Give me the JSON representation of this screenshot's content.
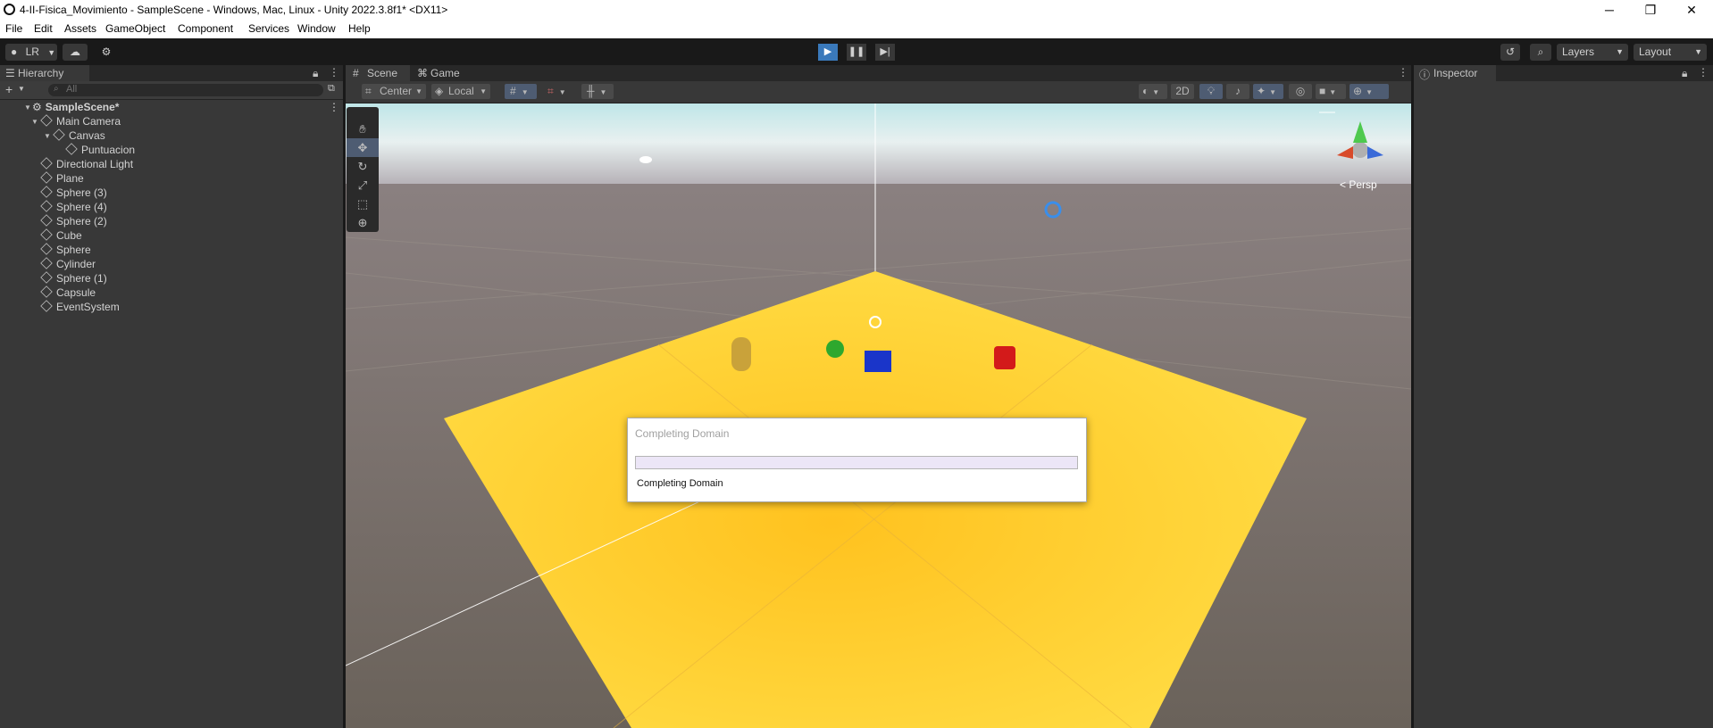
{
  "window": {
    "title": "4-II-Fisica_Movimiento - SampleScene - Windows, Mac, Linux - Unity 2022.3.8f1* <DX11>",
    "controls": {
      "minimize": "─",
      "restore": "❐",
      "close": "✕"
    }
  },
  "menu": [
    "File",
    "Edit",
    "Assets",
    "GameObject",
    "Component",
    "Services",
    "Window",
    "Help"
  ],
  "toolbar": {
    "account_label": "LR",
    "layers_label": "Layers",
    "layout_label": "Layout"
  },
  "hierarchy": {
    "tab": "Hierarchy",
    "search_placeholder": "All",
    "scene_name": "SampleScene*",
    "items": [
      {
        "label": "Main Camera",
        "depth": 1,
        "expanded": true
      },
      {
        "label": "Canvas",
        "depth": 2,
        "expanded": true
      },
      {
        "label": "Puntuacion",
        "depth": 3
      },
      {
        "label": "Directional Light",
        "depth": 1
      },
      {
        "label": "Plane",
        "depth": 1
      },
      {
        "label": "Sphere (3)",
        "depth": 1
      },
      {
        "label": "Sphere (4)",
        "depth": 1
      },
      {
        "label": "Sphere (2)",
        "depth": 1
      },
      {
        "label": "Cube",
        "depth": 1
      },
      {
        "label": "Sphere",
        "depth": 1
      },
      {
        "label": "Cylinder",
        "depth": 1
      },
      {
        "label": "Sphere (1)",
        "depth": 1
      },
      {
        "label": "Capsule",
        "depth": 1
      },
      {
        "label": "EventSystem",
        "depth": 1
      }
    ]
  },
  "scene": {
    "tabs": [
      "Scene",
      "Game"
    ],
    "pivot_label": "Center",
    "space_label": "Local",
    "mode_2d": "2D",
    "persp_label": "< Persp"
  },
  "inspector": {
    "tab": "Inspector"
  },
  "dialog": {
    "title": "Completing Domain",
    "message": "Completing Domain",
    "progress": 1.0
  },
  "colors": {
    "accent_blue": "#3a79bb",
    "plane_yellow": "#ffd740",
    "progress_fill": "#8f6cd6"
  }
}
